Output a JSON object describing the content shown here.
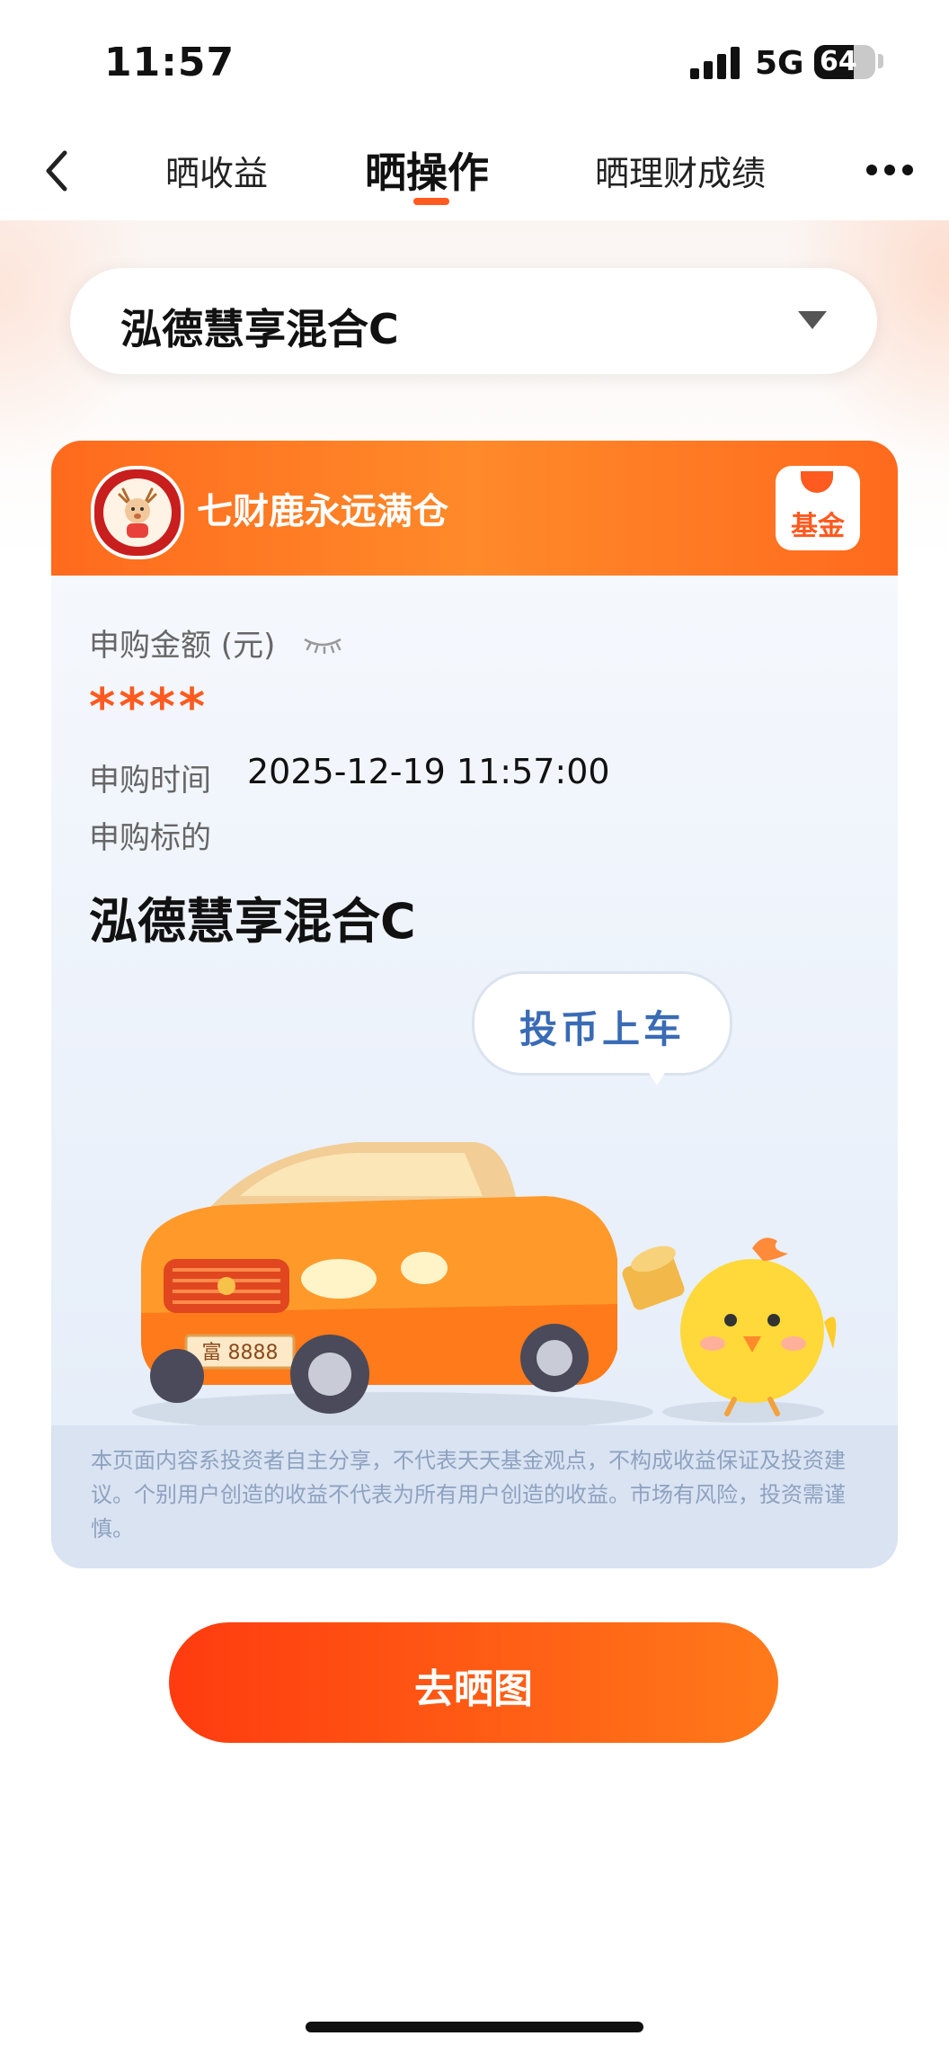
{
  "status_bar": {
    "time": "11:57",
    "network": "5G",
    "battery": "64"
  },
  "nav": {
    "tabs": [
      {
        "label": "晒收益"
      },
      {
        "label": "晒操作"
      },
      {
        "label": "晒理财成绩"
      }
    ],
    "active_tab_index": 1
  },
  "fund_selector": {
    "selected": "泓德慧享混合C"
  },
  "card": {
    "title": "七财鹿永远满仓",
    "badge": "基金",
    "amount_label": "申购金额 (元)",
    "amount_masked": "****",
    "time_label": "申购时间",
    "time_value": "2025-12-19 11:57:00",
    "target_label": "申购标的",
    "target_value": "泓德慧享混合C",
    "bubble_text": "投币上车",
    "plate_text": "富 8888",
    "disclaimer": "本页面内容系投资者自主分享，不代表天天基金观点，不构成收益保证及投资建议。个别用户创造的收益不代表为所有用户创造的收益。市场有风险，投资需谨慎。"
  },
  "cta": {
    "label": "去晒图"
  },
  "colors": {
    "accent": "#ff5a1f",
    "header": "#ff6a1d",
    "bubble_text": "#3a6bb5"
  }
}
